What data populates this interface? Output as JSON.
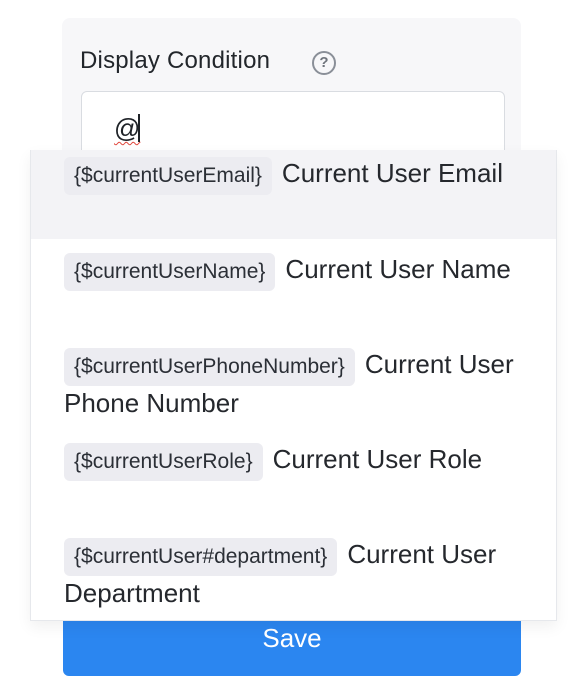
{
  "form": {
    "field_label": "Display Condition",
    "help_icon": "question-circle-icon",
    "input_value": "@"
  },
  "suggestions": [
    {
      "token": "{$currentUserEmail}",
      "label": "Current User Email",
      "active": true
    },
    {
      "token": "{$currentUserName}",
      "label": "Current User Name",
      "active": false
    },
    {
      "token": "{$currentUserPhoneNumber}",
      "label": "Current User Phone Number",
      "active": false
    },
    {
      "token": "{$currentUserRole}",
      "label": "Current User Role",
      "active": false
    },
    {
      "token": "{$currentUser#department}",
      "label": "Current User Department",
      "active": false
    }
  ],
  "actions": {
    "save_label": "Save"
  },
  "colors": {
    "accent": "#2b86f0",
    "token_bg": "#ececf1",
    "active_row_bg": "#f3f3f6"
  }
}
